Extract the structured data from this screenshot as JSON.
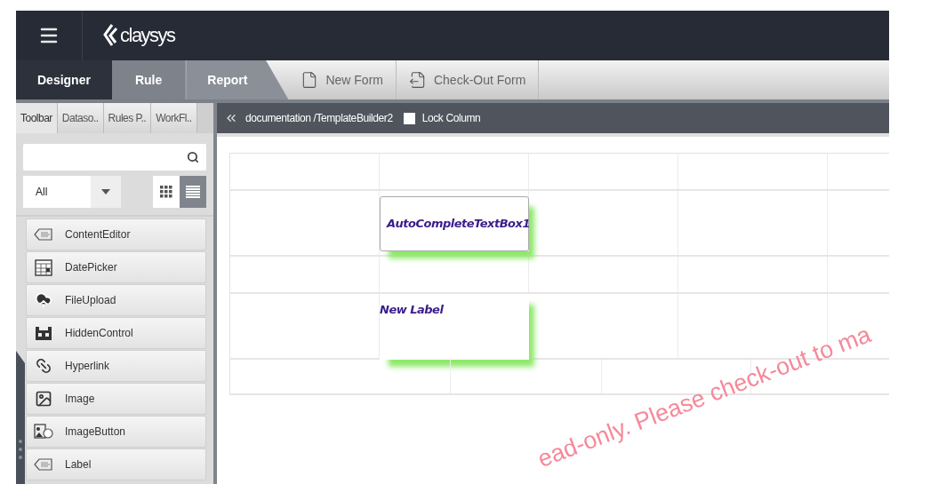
{
  "header": {
    "logo": "claysys"
  },
  "tabs": [
    {
      "label": "Designer",
      "selected": true
    },
    {
      "label": "Rule",
      "selected": false
    },
    {
      "label": "Report",
      "selected": false
    }
  ],
  "toolbar_buttons": [
    {
      "label": "New Form",
      "kind": "new"
    },
    {
      "label": "Check-Out Form",
      "kind": "checkout"
    }
  ],
  "panel_tabs": [
    {
      "label": "Toolbar",
      "selected": true
    },
    {
      "label": "Dataso..",
      "selected": false
    },
    {
      "label": "Rules P..",
      "selected": false
    },
    {
      "label": "WorkFl..",
      "selected": false
    }
  ],
  "filter": {
    "value": "All"
  },
  "view_modes": [
    {
      "kind": "grid",
      "selected": false
    },
    {
      "kind": "list",
      "selected": true
    }
  ],
  "controls": [
    {
      "label": "ContentEditor",
      "kind": "tag"
    },
    {
      "label": "DatePicker",
      "kind": "calendar"
    },
    {
      "label": "FileUpload",
      "kind": "upload"
    },
    {
      "label": "HiddenControl",
      "kind": "hidden"
    },
    {
      "label": "Hyperlink",
      "kind": "link"
    },
    {
      "label": "Image",
      "kind": "image"
    },
    {
      "label": "ImageButton",
      "kind": "imagebutton"
    },
    {
      "label": "Label",
      "kind": "tag"
    }
  ],
  "breadcrumb": {
    "path": "documentation /TemplateBuilder2",
    "lock_column": {
      "label": "Lock Column",
      "checked": false
    }
  },
  "placed": [
    {
      "text": "AutoCompleteTextBox1",
      "kind": "textbox"
    },
    {
      "text": "New Label",
      "kind": "label"
    }
  ],
  "notice": "ead-only. Please check-out to ma"
}
